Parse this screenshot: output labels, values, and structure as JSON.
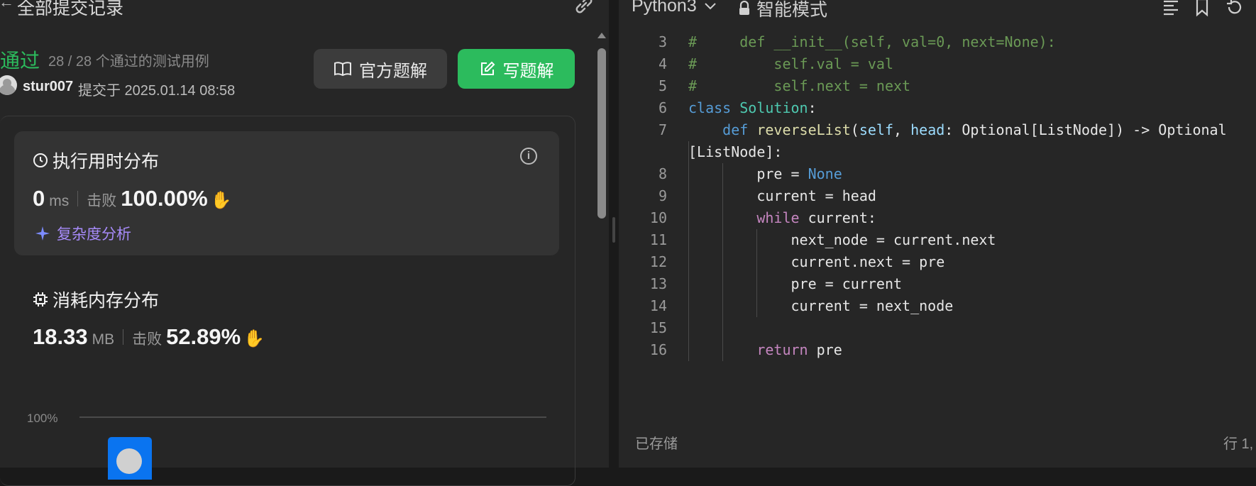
{
  "header": {
    "back_label": "←",
    "title": "全部提交记录"
  },
  "submission": {
    "status": "通过",
    "cases": "28 / 28 个通过的测试用例",
    "user": "stur007",
    "submitted_at": "提交于 2025.01.14 08:58"
  },
  "buttons": {
    "official": "官方题解",
    "write": "写题解"
  },
  "runtime": {
    "title": "执行用时分布",
    "value": "0",
    "unit": "ms",
    "beat_label": "击败",
    "beat_value": "100.00%",
    "analysis": "复杂度分析"
  },
  "memory": {
    "title": "消耗内存分布",
    "value": "18.33",
    "unit": "MB",
    "beat_label": "击败",
    "beat_value": "52.89%"
  },
  "chart": {
    "y_tick": "100%"
  },
  "editor": {
    "language": "Python3",
    "mode": "智能模式",
    "footer_left": "已存储",
    "footer_right": "行 1,",
    "lines": [
      {
        "n": "3",
        "tokens": [
          {
            "t": "#     def __init__(self, val=0, next=None):",
            "c": "c-comment"
          }
        ]
      },
      {
        "n": "4",
        "tokens": [
          {
            "t": "#         self.val = val",
            "c": "c-comment"
          }
        ]
      },
      {
        "n": "5",
        "tokens": [
          {
            "t": "#         self.next = next",
            "c": "c-comment"
          }
        ]
      },
      {
        "n": "6",
        "tokens": [
          {
            "t": "class ",
            "c": "c-kw"
          },
          {
            "t": "Solution",
            "c": "c-cls"
          },
          {
            "t": ":",
            "c": ""
          }
        ]
      },
      {
        "n": "7",
        "tokens": [
          {
            "t": "    ",
            "c": ""
          },
          {
            "t": "def ",
            "c": "c-kw"
          },
          {
            "t": "reverseList",
            "c": "c-fn"
          },
          {
            "t": "(",
            "c": ""
          },
          {
            "t": "self",
            "c": "c-param"
          },
          {
            "t": ", ",
            "c": ""
          },
          {
            "t": "head",
            "c": "c-param"
          },
          {
            "t": ": Optional[ListNode]) -> Optional",
            "c": ""
          }
        ]
      },
      {
        "n": "",
        "tokens": [
          {
            "t": "[ListNode]:",
            "c": ""
          }
        ]
      },
      {
        "n": "8",
        "tokens": [
          {
            "t": "        pre = ",
            "c": ""
          },
          {
            "t": "None",
            "c": "c-kw"
          }
        ]
      },
      {
        "n": "9",
        "tokens": [
          {
            "t": "        current = head",
            "c": ""
          }
        ]
      },
      {
        "n": "10",
        "tokens": [
          {
            "t": "        ",
            "c": ""
          },
          {
            "t": "while",
            "c": "c-ctrl"
          },
          {
            "t": " current:",
            "c": ""
          }
        ]
      },
      {
        "n": "11",
        "tokens": [
          {
            "t": "            next_node = current.next",
            "c": ""
          }
        ]
      },
      {
        "n": "12",
        "tokens": [
          {
            "t": "            current.next = pre",
            "c": ""
          }
        ]
      },
      {
        "n": "13",
        "tokens": [
          {
            "t": "            pre = current",
            "c": ""
          }
        ]
      },
      {
        "n": "14",
        "tokens": [
          {
            "t": "            current = next_node",
            "c": ""
          }
        ]
      },
      {
        "n": "15",
        "tokens": [
          {
            "t": "",
            "c": ""
          }
        ]
      },
      {
        "n": "16",
        "tokens": [
          {
            "t": "        ",
            "c": ""
          },
          {
            "t": "return",
            "c": "c-ctrl"
          },
          {
            "t": " pre",
            "c": ""
          }
        ]
      }
    ]
  },
  "colors": {
    "accent_green": "#2cbb5d",
    "panel_bg": "#262626",
    "card_bg": "#333333",
    "analysis_purple": "#a78bfa",
    "chart_bar": "#0a74f0"
  },
  "icons": {
    "back": "arrow-left-icon",
    "link": "link-icon",
    "book": "book-icon",
    "edit": "edit-icon",
    "clock": "clock-icon",
    "chip": "chip-icon",
    "info": "info-icon",
    "sparkle": "sparkle-icon",
    "clap": "clap-icon",
    "lock": "lock-icon",
    "chevron": "chevron-down-icon",
    "format": "format-icon",
    "bookmark": "bookmark-icon",
    "reset": "reset-icon"
  }
}
